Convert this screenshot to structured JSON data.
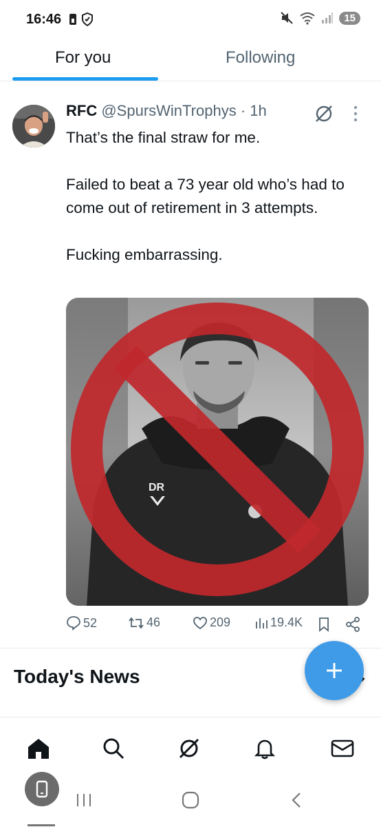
{
  "status_bar": {
    "time": "16:46",
    "notification_count": "15",
    "icons": [
      "sim-card-icon",
      "shield-icon",
      "mute-icon",
      "wifi-icon",
      "signal-icon"
    ]
  },
  "tabs": [
    {
      "label": "For you",
      "active": true
    },
    {
      "label": "Following",
      "active": false
    }
  ],
  "tweet": {
    "display_name": "RFC",
    "handle": "@SpursWinTrophys",
    "separator": "·",
    "time": "1h",
    "paragraphs": [
      "That’s the final straw for me.",
      "Failed to beat a 73 year old who’s had to come out of retirement in 3 attempts.",
      "Fucking embarrassing."
    ],
    "media_jacket_text": "DR",
    "stats": {
      "replies": "52",
      "reposts": "46",
      "likes": "209",
      "views": "19.4K"
    }
  },
  "section": {
    "title": "Today's News"
  },
  "bottom_nav": [
    "home-icon",
    "search-icon",
    "grok-icon",
    "notifications-icon",
    "messages-icon"
  ],
  "colors": {
    "accent": "#1d9bf0",
    "fab": "#3f9be8",
    "secondary_text": "#536471",
    "prohibition_red": "#c0282d"
  }
}
